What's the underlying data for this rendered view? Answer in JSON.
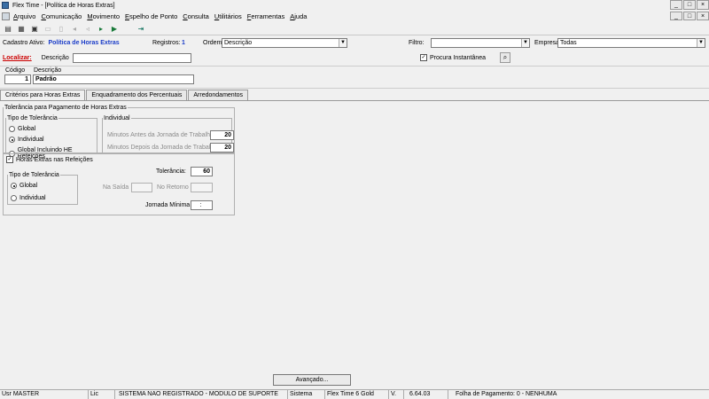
{
  "window": {
    "title": "Flex Time - [Política de Horas Extras]",
    "min": "_",
    "max": "□",
    "close": "×"
  },
  "menu": [
    {
      "u": "A",
      "rest": "rquivo"
    },
    {
      "u": "C",
      "rest": "omunicação"
    },
    {
      "u": "M",
      "rest": "ovimento"
    },
    {
      "u": "E",
      "rest": "spelho de Ponto"
    },
    {
      "u": "C",
      "rest": "onsulta"
    },
    {
      "u": "U",
      "rest": "tilitários"
    },
    {
      "u": "F",
      "rest": "erramentas"
    },
    {
      "u": "A",
      "rest": "juda"
    }
  ],
  "toolbar": {
    "icons": [
      "new-icon",
      "edit-icon",
      "copy-icon",
      "save-icon",
      "delete-icon",
      "first-icon",
      "prev-icon",
      "next-icon",
      "last-icon",
      "exit-icon"
    ]
  },
  "header": {
    "cadastro_label": "Cadastro Ativo:",
    "cadastro_value": "Política de Horas Extras",
    "registros_label": "Registros:",
    "registros_value": "1",
    "ordem_label": "Ordem:",
    "ordem_value": "Descrição",
    "filtro_label": "Filtro:",
    "filtro_value": "",
    "empresa_label": "Empresa",
    "empresa_value": "Todas"
  },
  "localizar": {
    "label": "Localizar:",
    "descricao_label": "Descrição",
    "search_value": "",
    "procura_label": "Procura Instantânea",
    "procura_checked": "✓"
  },
  "record": {
    "codigo_label": "Código",
    "codigo_value": "1",
    "descricao_label": "Descrição",
    "descricao_value": "Padrão"
  },
  "tabs": [
    "Critérios para Horas Extras",
    "Enquadramento dos Percentuais",
    "Arredondamentos"
  ],
  "tolerancia_pagamento": {
    "legend": "Tolerância para Pagamento de Horas Extras",
    "tipo_legend": "Tipo de Tolerância",
    "options": [
      "Global",
      "Individual",
      "Global Incluindo HE Refeições"
    ],
    "selected": "Individual",
    "individual_legend": "Individual",
    "minutos_antes_label": "Minutos Antes da Jornada de Trabalho",
    "minutos_antes_value": "20",
    "minutos_depois_label": "Minutos Depois da Jornada de Trabalho",
    "minutos_depois_value": "20"
  },
  "refeicoes": {
    "checkbox_label": "Horas Extras nas Refeições",
    "checked": "✓",
    "tipo_legend": "Tipo de Tolerância",
    "options": [
      "Global",
      "Individual"
    ],
    "selected": "Global",
    "tolerancia_label": "Tolerância:",
    "tolerancia_value": "60",
    "na_saida_label": "Na Saída",
    "na_saida_value": "",
    "no_retorno_label": "No Retorno",
    "no_retorno_value": "",
    "jornada_minima_label": "Jornada Mínima",
    "jornada_minima_value": ":"
  },
  "advanced_button": "Avançado...",
  "statusbar": [
    "Usr MASTER",
    "Lic",
    "SISTEMA NAO REGISTRADO - MODULO DE SUPORTE",
    "Sistema",
    "Flex Time 6 Gold",
    "V.",
    "6.64.03",
    "Folha de Pagamento: 0 - NENHUMA"
  ]
}
